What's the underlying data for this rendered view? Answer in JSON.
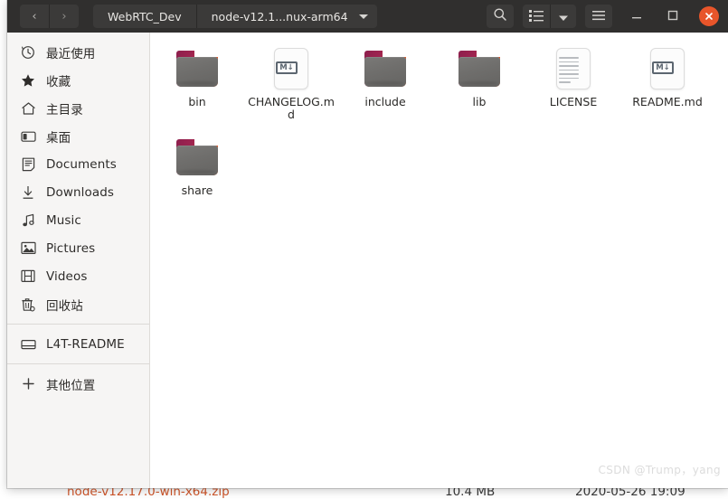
{
  "window": {
    "title": "node-v12.1...nux-arm64"
  },
  "headerbar": {
    "nav_back": "‹",
    "nav_forward": "›",
    "path_buttons": [
      {
        "label": "WebRTC_Dev",
        "current": false
      },
      {
        "label": "node-v12.1...nux-arm64",
        "current": true
      }
    ],
    "search_icon": "search-icon",
    "view_list_icon": "list-view-icon",
    "view_dropdown_icon": "chevron-down-icon",
    "menu_icon": "hamburger-menu-icon",
    "minimize_icon": "minimize-icon",
    "maximize_icon": "maximize-icon",
    "close_icon": "close-icon",
    "close_color": "#e8552a"
  },
  "sidebar": {
    "items": [
      {
        "label": "最近使用",
        "icon": "clock-icon",
        "type": "item"
      },
      {
        "label": "收藏",
        "icon": "star-icon",
        "type": "item"
      },
      {
        "label": "主目录",
        "icon": "home-icon",
        "type": "item"
      },
      {
        "label": "桌面",
        "icon": "desktop-icon",
        "type": "item"
      },
      {
        "label": "Documents",
        "icon": "documents-icon",
        "type": "item"
      },
      {
        "label": "Downloads",
        "icon": "download-icon",
        "type": "item"
      },
      {
        "label": "Music",
        "icon": "music-note-icon",
        "type": "item"
      },
      {
        "label": "Pictures",
        "icon": "picture-icon",
        "type": "item"
      },
      {
        "label": "Videos",
        "icon": "film-icon",
        "type": "item"
      },
      {
        "label": "回收站",
        "icon": "trash-icon",
        "type": "item"
      },
      {
        "label": "",
        "icon": "",
        "type": "separator"
      },
      {
        "label": "L4T-README",
        "icon": "drive-icon",
        "type": "item"
      },
      {
        "label": "",
        "icon": "",
        "type": "separator"
      },
      {
        "label": "其他位置",
        "icon": "plus-icon",
        "type": "item"
      }
    ]
  },
  "files": {
    "items": [
      {
        "name": "bin",
        "kind": "folder"
      },
      {
        "name": "CHANGELOG.md",
        "kind": "markdown"
      },
      {
        "name": "include",
        "kind": "folder"
      },
      {
        "name": "lib",
        "kind": "folder"
      },
      {
        "name": "LICENSE",
        "kind": "text"
      },
      {
        "name": "README.md",
        "kind": "markdown"
      },
      {
        "name": "share",
        "kind": "folder"
      }
    ],
    "markdown_badge_text": "M↓"
  },
  "background_row": {
    "name": "node-v12.17.0-win-x64.zip",
    "size": "10.4 MB",
    "date": "2020-05-26 19:09"
  },
  "watermark": {
    "text": "CSDN @Trump，yang"
  }
}
